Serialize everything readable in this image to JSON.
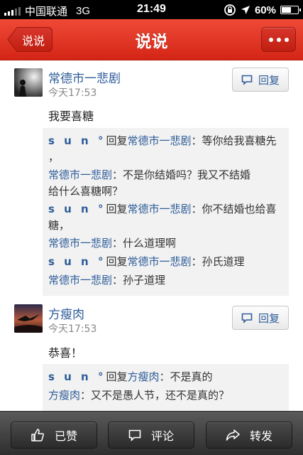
{
  "status_bar": {
    "carrier": "中国联通",
    "network": "3G",
    "time": "21:49",
    "battery": "60%",
    "battery_level": 0.6
  },
  "navbar": {
    "back_label": "说说",
    "title": "说说",
    "more_icon": "ellipsis-icon"
  },
  "posts": [
    {
      "username": "常德市一悲剧",
      "time": "今天17:53",
      "reply_label": "回复",
      "text": "我要喜糖",
      "comments": [
        {
          "user": "s u n °",
          "reply_word": "回复",
          "target": "常德市一悲剧",
          "sep": "：",
          "text": "等你给我喜糖先"
        },
        {
          "text2": "，"
        },
        {
          "user": "常德市一悲剧",
          "sep": "：",
          "text": "不是你结婚吗？我又不结婚"
        },
        {
          "text2": "给什么喜糖啊？"
        },
        {
          "user": "s u n °",
          "reply_word": "回复",
          "target": "常德市一悲剧",
          "sep": "：",
          "text": "你不结婚也给喜"
        },
        {
          "text2": "糖，"
        },
        {
          "user": "常德市一悲剧",
          "sep": "：",
          "text": "什么道理啊"
        },
        {
          "user": "s u n °",
          "reply_word": "回复",
          "target": "常德市一悲剧",
          "sep": "：",
          "text": "孙氏道理"
        },
        {
          "user": "常德市一悲剧",
          "sep": "：",
          "text": "孙子道理"
        }
      ]
    },
    {
      "username": "方瘦肉",
      "time": "今天17:53",
      "reply_label": "回复",
      "text": "恭喜！",
      "comments": [
        {
          "user": "s u n °",
          "reply_word": "回复",
          "target": "方瘦肉",
          "sep": "：",
          "text": "不是真的"
        },
        {
          "user": "方瘦肉",
          "sep": "：",
          "text": "又不是愚人节，还不是真的？"
        }
      ]
    }
  ],
  "toolbar": {
    "like_label": "已赞",
    "comment_label": "评论",
    "share_label": "转发"
  },
  "colors": {
    "accent_red": "#d42516",
    "link_blue": "#2f5d99"
  }
}
